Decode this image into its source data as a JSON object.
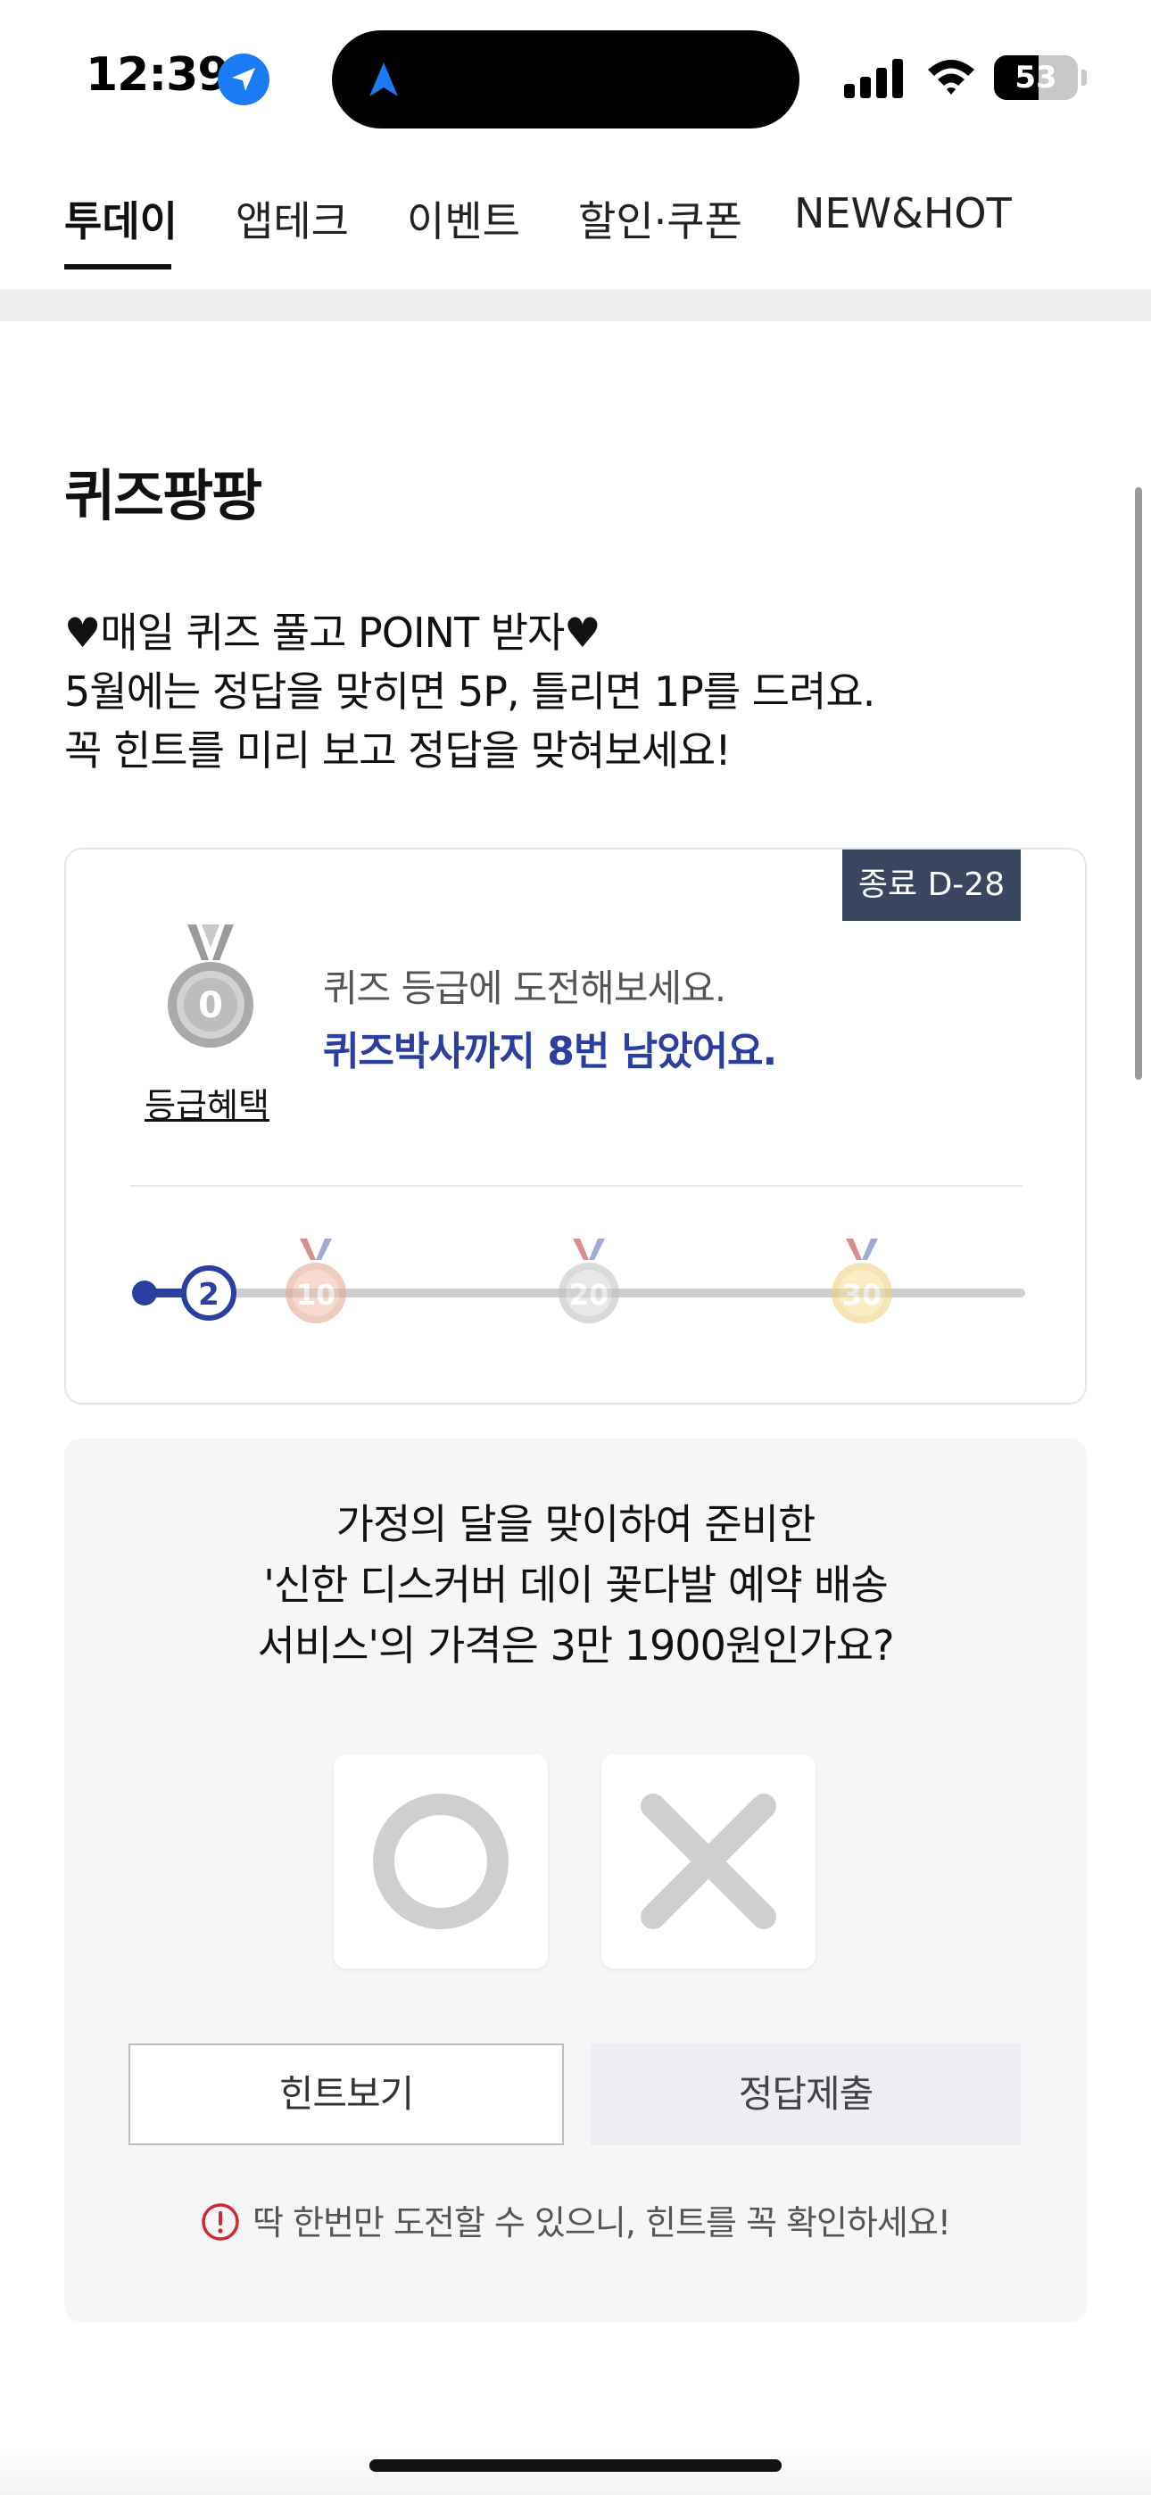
{
  "status_bar": {
    "time": "12:39",
    "battery": "53",
    "battery_level": 0.53,
    "icons": [
      "location-arrow-icon",
      "navigation-icon",
      "cellular-signal-icon",
      "wifi-icon",
      "battery-icon"
    ]
  },
  "top_tabs": [
    {
      "label": "투데이",
      "active": true
    },
    {
      "label": "앱테크",
      "active": false
    },
    {
      "label": "이벤트",
      "active": false
    },
    {
      "label": "할인·쿠폰",
      "active": false
    },
    {
      "label": "NEW&HOT",
      "active": false
    }
  ],
  "section": {
    "title": "퀴즈팡팡",
    "intro_lines": [
      "♥매일 퀴즈 풀고 POINT 받자♥",
      "5월에는 정답을 맞히면 5P, 틀리면 1P를 드려요.",
      "꼭 힌트를 미리 보고 정답을 맞혀보세요!"
    ]
  },
  "grade_card": {
    "dday_badge": "종료 D-28",
    "medal_level": "0",
    "benefit_link": "등급혜택",
    "line1": "퀴즈 등급에 도전해보세요.",
    "line2": "퀴즈박사까지 8번 남았어요.",
    "progress": {
      "current": "2",
      "milestones": [
        "10",
        "20",
        "30"
      ],
      "accent_color": "#2b3fa0"
    }
  },
  "quiz": {
    "question_lines": [
      "가정의 달을 맞이하여 준비한",
      "'신한 디스커버 데이 꽃다발 예약 배송",
      "서비스'의 가격은 3만 1900원인가요?"
    ],
    "answer_o_icon": "circle-o-icon",
    "answer_x_icon": "cross-x-icon",
    "hint_button": "힌트보기",
    "submit_button": "정답제출",
    "notice": "딱 한번만 도전할 수 있으니, 힌트를 꼭 확인하세요!",
    "notice_color": "#d0282e"
  }
}
